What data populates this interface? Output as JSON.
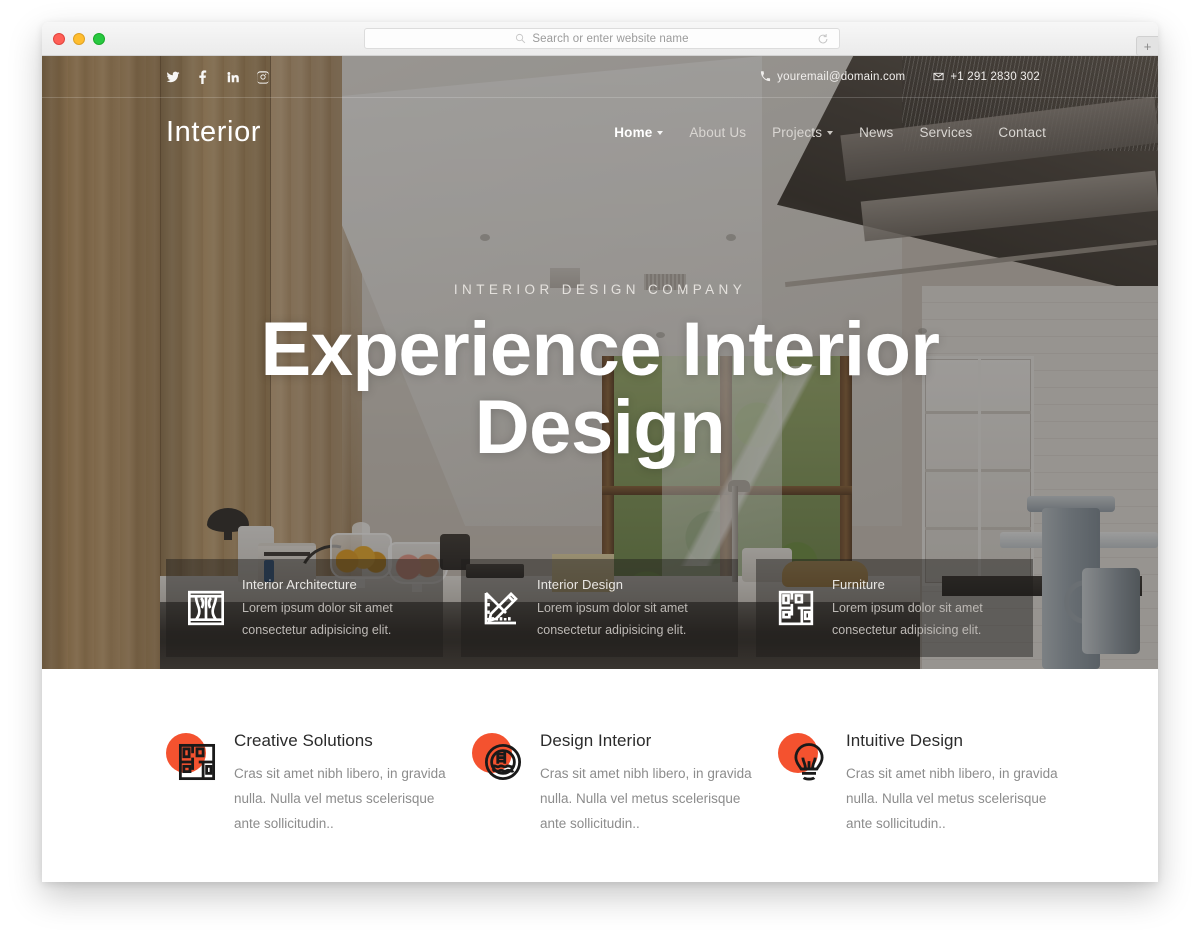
{
  "browser": {
    "search_placeholder": "Search or enter website name",
    "search_value": "",
    "reload_label": "",
    "new_tab_label": "+",
    "traffic_lights": [
      "close",
      "minimize",
      "maximize"
    ]
  },
  "site": {
    "logo": "Interior",
    "topbar": {
      "social": [
        {
          "name": "twitter-icon",
          "label": "Twitter"
        },
        {
          "name": "facebook-icon",
          "label": "Facebook"
        },
        {
          "name": "linkedin-icon",
          "label": "LinkedIn"
        },
        {
          "name": "instagram-icon",
          "label": "Instagram"
        }
      ],
      "email": "youremail@domain.com",
      "phone": "+1 291 2830 302"
    },
    "nav": [
      {
        "label": "Home",
        "has_dropdown": true,
        "active": true
      },
      {
        "label": "About Us",
        "has_dropdown": false,
        "active": false
      },
      {
        "label": "Projects",
        "has_dropdown": true,
        "active": false
      },
      {
        "label": "News",
        "has_dropdown": false,
        "active": false
      },
      {
        "label": "Services",
        "has_dropdown": false,
        "active": false
      },
      {
        "label": "Contact",
        "has_dropdown": false,
        "active": false
      }
    ],
    "hero": {
      "eyebrow": "INTERIOR DESIGN COMPANY",
      "title": "Experience Interior Design",
      "cards": [
        {
          "icon": "curtain-window-icon",
          "title": "Interior Architecture",
          "text": "Lorem ipsum dolor sit amet consectetur adipisicing elit."
        },
        {
          "icon": "ruler-pencil-icon",
          "title": "Interior Design",
          "text": "Lorem ipsum dolor sit amet consectetur adipisicing elit."
        },
        {
          "icon": "floor-plan-icon",
          "title": "Furniture",
          "text": "Lorem ipsum dolor sit amet consectetur adipisicing elit."
        }
      ]
    },
    "features": [
      {
        "icon": "floor-plan-icon",
        "title": "Creative Solutions",
        "text": "Cras sit amet nibh libero, in gravida nulla. Nulla vel metus scelerisque ante sollicitudin.."
      },
      {
        "icon": "pool-icon",
        "title": "Design Interior",
        "text": "Cras sit amet nibh libero, in gravida nulla. Nulla vel metus scelerisque ante sollicitudin.."
      },
      {
        "icon": "lightbulb-icon",
        "title": "Intuitive Design",
        "text": "Cras sit amet nibh libero, in gravida nulla. Nulla vel metus scelerisque ante sollicitudin.."
      }
    ],
    "colors": {
      "accent": "#F4522F",
      "hero_overlay": "#282624",
      "card_title": "#E9E7E4",
      "body_text": "#8C8C8C"
    }
  }
}
